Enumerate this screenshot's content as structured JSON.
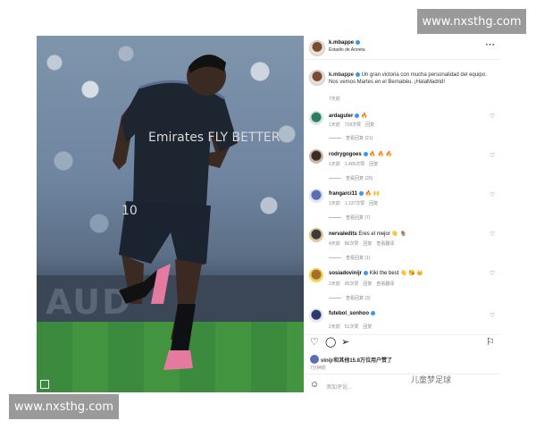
{
  "watermarks": {
    "top": "www.nxsthg.com",
    "bottom": "www.nxsthg.com",
    "sticker": "儿童梦足球"
  },
  "post": {
    "username": "k.mbappe",
    "location": "Estadio de Anoeta",
    "caption_user": "k.mbappe",
    "caption": "Un gran victoria con mucha personalidad del equipo. Nos vemos Martes en el Bernabéu. ¡HalaMadrid!",
    "caption_time": "7天前",
    "likes": "vinijr和其他15.8万位用户赞了",
    "post_time": "7分钟前",
    "add_comment_placeholder": "添加评论...",
    "jersey_text": "Emirates FLY BETTER"
  },
  "comments": [
    {
      "user": "ardaguler",
      "text": "🔥",
      "time": "1天前",
      "likes": "718次赞",
      "reply": "回复",
      "view_replies": "查看回复 (21)"
    },
    {
      "user": "rodrygogoes",
      "text": "🔥 🔥 🔥",
      "time": "1天前",
      "likes": "1,405次赞",
      "reply": "回复",
      "view_replies": "查看回复 (25)"
    },
    {
      "user": "frangarci11",
      "text": "🔥 🙌",
      "time": "1天前",
      "likes": "1,137次赞",
      "reply": "回复",
      "view_replies": "查看回复 (7)"
    },
    {
      "user": "nervaledits",
      "text": "Eres el mejor 👋 🐐",
      "time": "4天前",
      "likes": "86次赞",
      "reply": "回复",
      "translate": "查看翻译",
      "view_replies": "查看回复 (1)"
    },
    {
      "user": "sosiadovinijr",
      "text": "Kiki the best 👋 😘 👑",
      "time": "2天前",
      "likes": "95次赞",
      "reply": "回复",
      "translate": "查看翻译",
      "view_replies": "查看回复 (3)"
    },
    {
      "user": "futebol_sonhoo",
      "text": "",
      "time": "2天前",
      "likes": "51次赞",
      "reply": "回复"
    }
  ],
  "icons": {
    "more": "more-options-icon",
    "heart": "heart-icon",
    "comment": "comment-icon",
    "share": "share-icon",
    "save": "bookmark-icon",
    "emoji": "emoji-icon"
  }
}
